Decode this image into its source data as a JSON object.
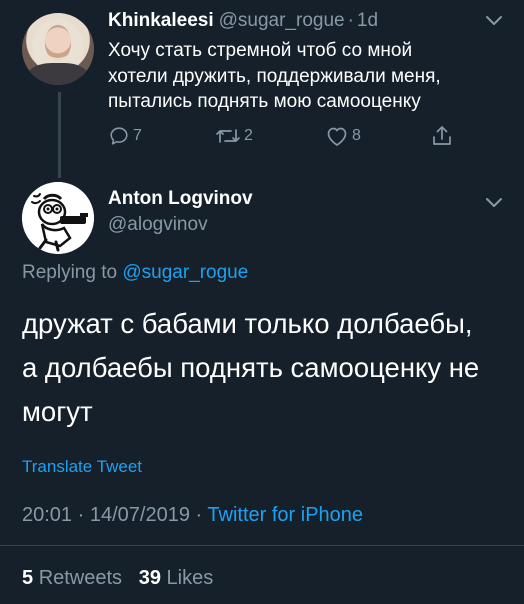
{
  "tweet_parent": {
    "name": "Khinkaleesi",
    "handle": "@sugar_rogue",
    "dot": "·",
    "age": "1d",
    "lines": [
      "Хочу стать стремной чтоб со мной",
      "хотели дружить, поддерживали меня,",
      "пытались поднять мою самооценку"
    ],
    "replies_count": "7",
    "retweets_count": "2",
    "likes_count": "8"
  },
  "tweet_main": {
    "name": "Anton Logvinov",
    "handle": "@alogvinov",
    "replying_prefix": "Replying to",
    "replying_handle": "@sugar_rogue",
    "lines": [
      "дружат с бабами только долбаебы,",
      "а долбаебы поднять самооценку не",
      "могут"
    ],
    "translate_label": "Translate Tweet",
    "time": "20:01",
    "date": "14/07/2019",
    "meta_sep": "·",
    "source": "Twitter for iPhone",
    "retweets_count": "5",
    "retweets_label": "Retweets",
    "likes_count": "39",
    "likes_label": "Likes"
  },
  "colors": {
    "background": "#15202b",
    "text": "#ffffff",
    "muted": "#8899a6",
    "accent": "#1da1f2",
    "divider": "#38444d"
  },
  "icons": [
    "chevron-down-icon",
    "reply-icon",
    "retweet-icon",
    "like-icon",
    "share-icon"
  ]
}
